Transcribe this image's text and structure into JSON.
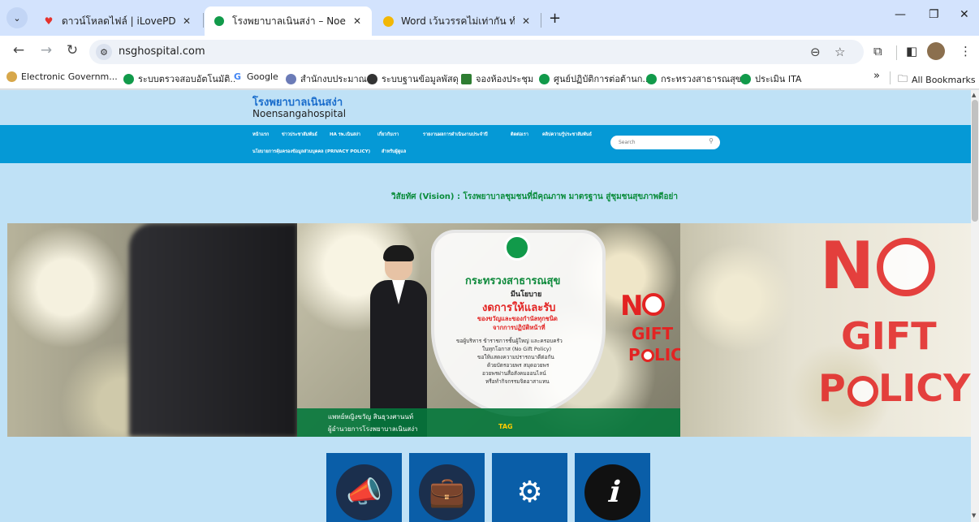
{
  "browser": {
    "tabs": [
      {
        "title": "ดาวน์โหลดไฟล์ | iLovePDF",
        "favicon": "heart-icon",
        "color": "#e5322d"
      },
      {
        "title": "โรงพยาบาลเนินสง่า – Noensangah",
        "favicon": "moph-logo-icon",
        "color": "#119a4a"
      },
      {
        "title": "Word เว้นวรรคไม่เท่ากัน ทำไงครับ? -",
        "favicon": "smiley-icon",
        "color": "#f2b705"
      }
    ],
    "new_tab_label": "+",
    "close_glyph": "✕",
    "url": "nsghospital.com",
    "bookmarks": [
      {
        "label": "Electronic Governm..."
      },
      {
        "label": "ระบบตรวจสอบอัตโนมัติ..."
      },
      {
        "label": "Google"
      },
      {
        "label": "สำนักงบประมาณ"
      },
      {
        "label": "ระบบฐานข้อมูลพัสดุ"
      },
      {
        "label": "จองห้องประชุม"
      },
      {
        "label": "ศูนย์ปฏิบัติการต่อต้านก..."
      },
      {
        "label": "กระทรวงสาธารณสุข"
      },
      {
        "label": "ประเมิน ITA"
      }
    ],
    "bookmarks_overflow": "»",
    "all_bookmarks": "All Bookmarks"
  },
  "site": {
    "title": "โรงพยาบาลเนินสง่า",
    "subtitle": "Noensangahospital",
    "menu": [
      "หน้าแรก",
      "ข่าวประชาสัมพันธ์",
      "HA รพ.เนินสง่า",
      "เกี่ยวกับเรา",
      "รายงานผลการดำเนินงานประจำปี",
      "ติดต่อเรา",
      "คลิปความรู้ประชาสัมพันธ์",
      "นโยบายการคุ้มครองข้อมูลส่วนบุคคล (PRIVACY POLICY)",
      "สำหรับผู้ดูแล"
    ],
    "search_placeholder": "Search",
    "vision": "วิสัยทัศ (Vision) : โรงพยาบาลชุมชนที่มีคุณภาพ มาตรฐาน สู่ชุมชนสุขภาพดีอย่า"
  },
  "banner": {
    "ministry": "กระทรวงสาธารณสุข",
    "policy_line1": "มีนโยบาย",
    "policy_line2": "งดการให้และรับ",
    "policy_line3": "ของขวัญและของกำนัลทุกชนิด",
    "policy_line4": "จากการปฏิบัติหน้าที่",
    "body_lines": [
      "ขอผู้บริหาร ข้าราชการชั้นผู้ใหญ่ และครอบครัว",
      "ในทุกโอกาส (No Gift Policy)",
      "ขอให้แสดงความปรารถนาดีต่อกัน",
      "ด้วยบัตรอวยพร สมุดอวยพร",
      "อวยพรผ่านสื่อสังคมออนไลน์",
      "หรือทำกิจกรรมจิตอาสาแทน"
    ],
    "no_text": "N",
    "gift_text": "GIFT",
    "policy_text": "P",
    "policy_text2": "LICY",
    "director_name": "แพทย์หญิงขวัญ สินธุวงศานนท์",
    "director_title": "ผู้อำนวยการโรงพยาบาลเนินสง่า",
    "tag_label": "TAG"
  },
  "tiles": [
    {
      "icon": "megaphone-icon",
      "glyph": "📣",
      "disc": "#1b2f4d"
    },
    {
      "icon": "briefcase-icon",
      "glyph": "💼",
      "disc": "#1b2f4d"
    },
    {
      "icon": "service-box-icon",
      "glyph": "⚙",
      "disc": "#0a5ea8"
    },
    {
      "icon": "info-icon",
      "glyph": "ℹ",
      "disc": "#111111"
    }
  ]
}
